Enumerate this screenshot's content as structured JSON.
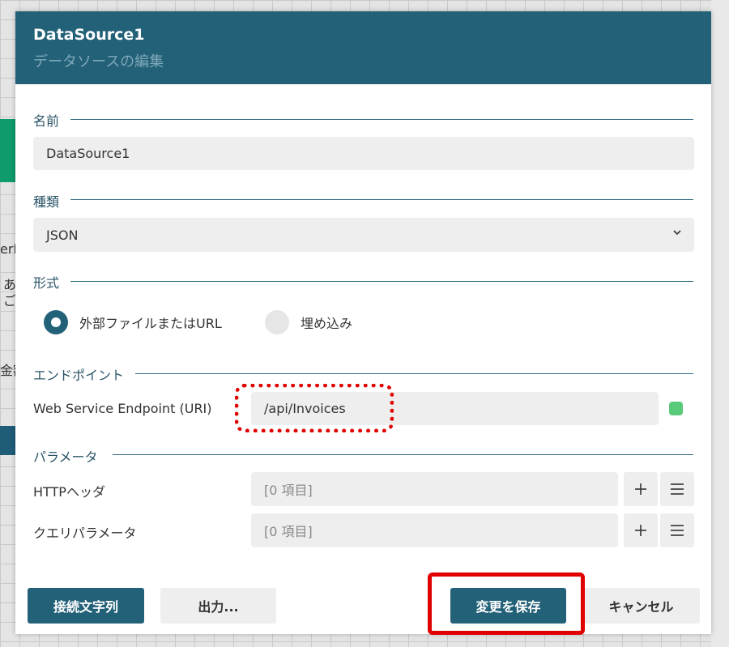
{
  "background": {
    "fragment_1": "erN",
    "fragment_2a": "あ",
    "fragment_2b": "ご",
    "fragment_3": "金額"
  },
  "dialog": {
    "title": "DataSource1",
    "subtitle": "データソースの編集"
  },
  "name_section": {
    "label": "名前",
    "value": "DataSource1"
  },
  "type_section": {
    "label": "種類",
    "value": "JSON"
  },
  "format_section": {
    "label": "形式",
    "options": [
      {
        "label": "外部ファイルまたはURL",
        "checked": true
      },
      {
        "label": "埋め込み",
        "checked": false
      }
    ]
  },
  "endpoint_section": {
    "label": "エンドポイント",
    "field_label": "Web Service Endpoint (URI)",
    "value": "/api/Invoices",
    "status_color": "#59c97a"
  },
  "params_section": {
    "label": "パラメータ",
    "rows": [
      {
        "label": "HTTPヘッダ",
        "value": "[0 項目]"
      },
      {
        "label": "クエリパラメータ",
        "value": "[0 項目]"
      }
    ]
  },
  "footer": {
    "connection_string_label": "接続文字列",
    "output_label": "出力...",
    "save_label": "変更を保存",
    "cancel_label": "キャンセル"
  },
  "colors": {
    "header": "#236178",
    "accent": "#236178",
    "highlight": "#e00000"
  }
}
